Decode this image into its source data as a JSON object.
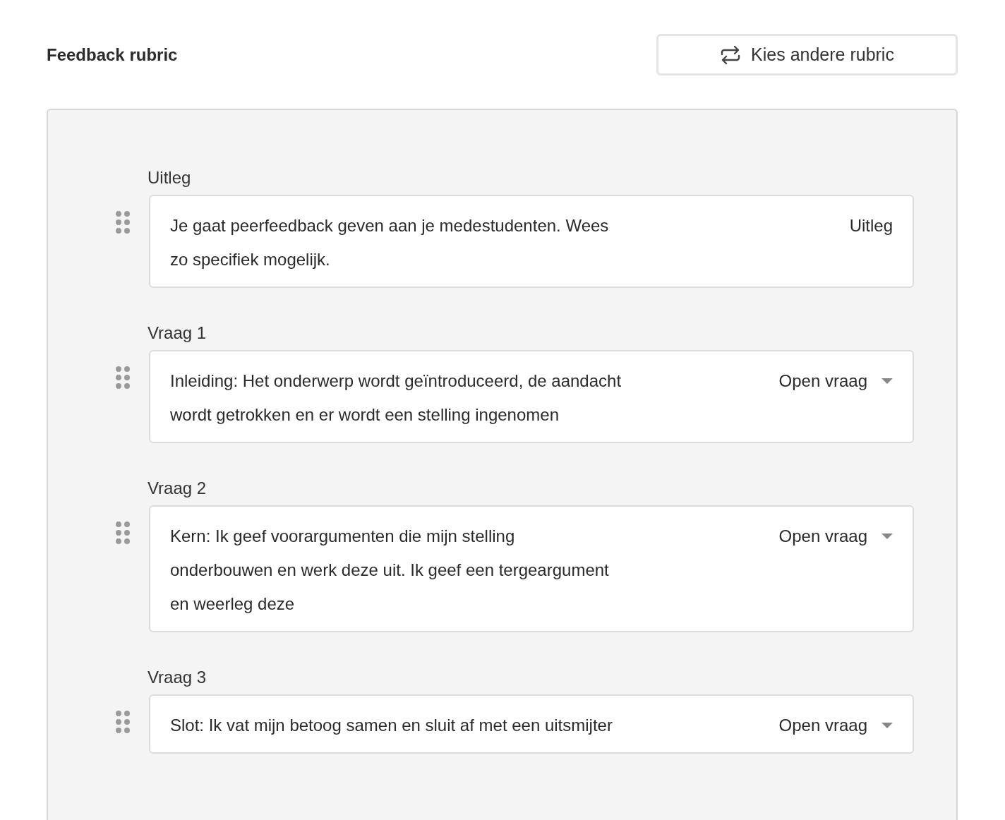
{
  "title": "Feedback rubric",
  "switch_button": {
    "label": "Kies andere rubric"
  },
  "items": [
    {
      "label": "Uitleg",
      "kind": "static",
      "text": "Je gaat peerfeedback geven aan je medestudenten. Wees zo specifiek mogelijk.",
      "type": "Uitleg"
    },
    {
      "label": "Vraag 1",
      "kind": "select",
      "text": "Inleiding: Het onderwerp wordt geïntroduceerd, de aandacht wordt getrokken en er wordt een stelling ingenomen",
      "type": "Open vraag"
    },
    {
      "label": "Vraag 2",
      "kind": "select",
      "text": "Kern: Ik geef voorargumenten die mijn stelling onderbouwen en werk deze uit. Ik geef een tergeargument en weerleg deze",
      "type": "Open vraag"
    },
    {
      "label": "Vraag 3",
      "kind": "select",
      "text": "Slot: Ik vat mijn betoog samen en sluit af met een uitsmijter",
      "type": "Open vraag"
    }
  ]
}
